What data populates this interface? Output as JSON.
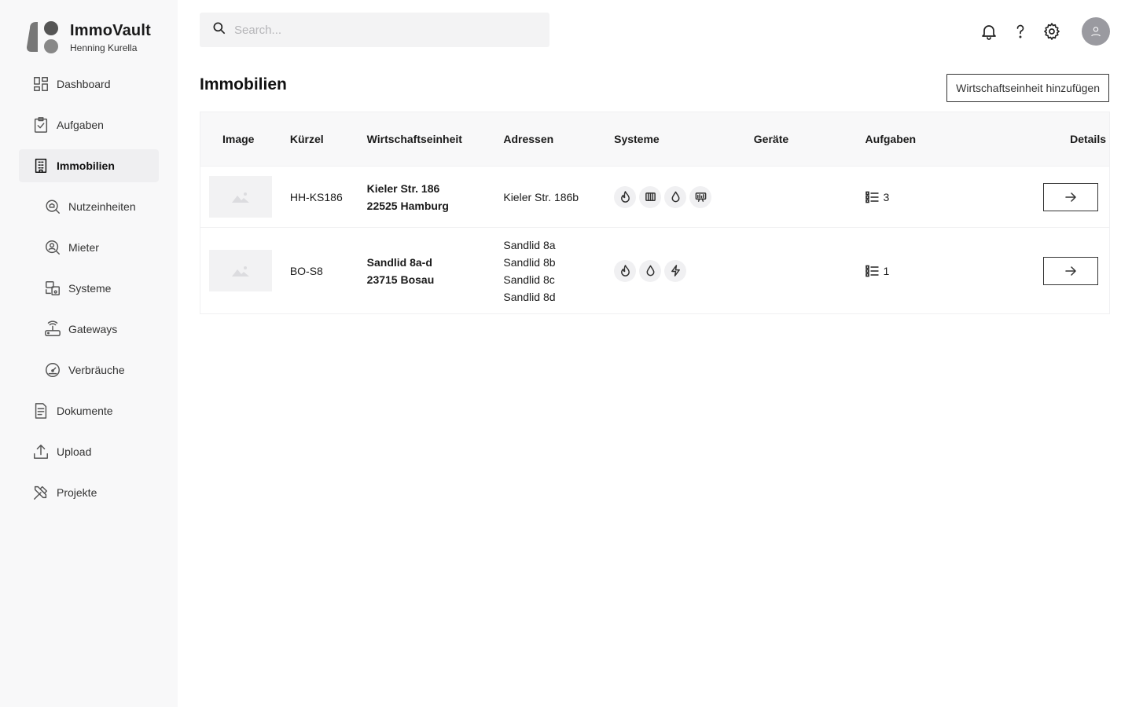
{
  "app": {
    "name": "ImmoVault",
    "user": "Henning Kurella"
  },
  "search": {
    "placeholder": "Search...",
    "value": ""
  },
  "sidebar": {
    "items": [
      {
        "label": "Dashboard",
        "icon": "dashboard-icon",
        "level": "top",
        "active": false
      },
      {
        "label": "Aufgaben",
        "icon": "clipboard-check-icon",
        "level": "top",
        "active": false
      },
      {
        "label": "Immobilien",
        "icon": "building-icon",
        "level": "top",
        "active": true
      },
      {
        "label": "Nutzeinheiten",
        "icon": "search-home-icon",
        "level": "sub",
        "active": false
      },
      {
        "label": "Mieter",
        "icon": "user-search-icon",
        "level": "sub",
        "active": false
      },
      {
        "label": "Systeme",
        "icon": "devices-icon",
        "level": "sub",
        "active": false
      },
      {
        "label": "Gateways",
        "icon": "router-icon",
        "level": "sub",
        "active": false
      },
      {
        "label": "Verbräuche",
        "icon": "gauge-icon",
        "level": "sub",
        "active": false
      },
      {
        "label": "Dokumente",
        "icon": "document-icon",
        "level": "top",
        "active": false
      },
      {
        "label": "Upload",
        "icon": "upload-icon",
        "level": "top",
        "active": false
      },
      {
        "label": "Projekte",
        "icon": "tools-icon",
        "level": "top",
        "active": false
      }
    ]
  },
  "header": {
    "icons": [
      "bell-icon",
      "help-icon",
      "gear-icon",
      "avatar-icon"
    ]
  },
  "main": {
    "title": "Immobilien",
    "add_button": "Wirtschaftseinheit hinzufügen",
    "table": {
      "columns": [
        "Image",
        "Kürzel",
        "Wirtschaftseinheit",
        "Adressen",
        "Systeme",
        "Geräte",
        "Aufgaben",
        "Details"
      ],
      "rows": [
        {
          "code": "HH-KS186",
          "unit_line1": "Kieler Str. 186",
          "unit_line2": "22525 Hamburg",
          "addresses": [
            "Kieler Str. 186b"
          ],
          "systems": [
            "heating-flame-icon",
            "radiator-icon",
            "water-drop-icon",
            "display-meter-icon"
          ],
          "devices": "",
          "tasks": "3"
        },
        {
          "code": "BO-S8",
          "unit_line1": "Sandlid 8a-d",
          "unit_line2": "23715 Bosau",
          "addresses": [
            "Sandlid 8a",
            "Sandlid 8b",
            "Sandlid 8c",
            "Sandlid 8d"
          ],
          "systems": [
            "heating-flame-icon",
            "water-drop-icon",
            "electricity-bolt-icon"
          ],
          "devices": "",
          "tasks": "1"
        }
      ]
    }
  },
  "colors": {
    "sidebar_bg": "#f8f8f9",
    "active_item_bg": "#efeff1",
    "text": "#1a1a1a",
    "avatar_bg": "#9a9aa0"
  }
}
